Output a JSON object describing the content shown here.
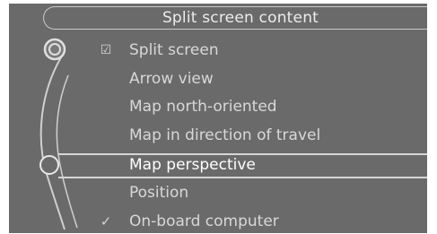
{
  "header": {
    "title": "Split screen content"
  },
  "menu": {
    "items": [
      {
        "label": "Split screen",
        "check": "☑",
        "checked": true
      },
      {
        "label": "Arrow view",
        "check": "",
        "checked": false
      },
      {
        "label": "Map north-oriented",
        "check": "",
        "checked": false
      },
      {
        "label": "Map in direction of travel",
        "check": "",
        "checked": false
      },
      {
        "label": "Map perspective",
        "check": "",
        "checked": false,
        "selected": true
      },
      {
        "label": "Position",
        "check": "",
        "checked": false
      },
      {
        "label": "On-board computer",
        "check": "✓",
        "checked": true
      }
    ]
  },
  "colors": {
    "background": "#6a6a6a",
    "text": "#d8d8d8",
    "highlight": "#ffffff"
  }
}
